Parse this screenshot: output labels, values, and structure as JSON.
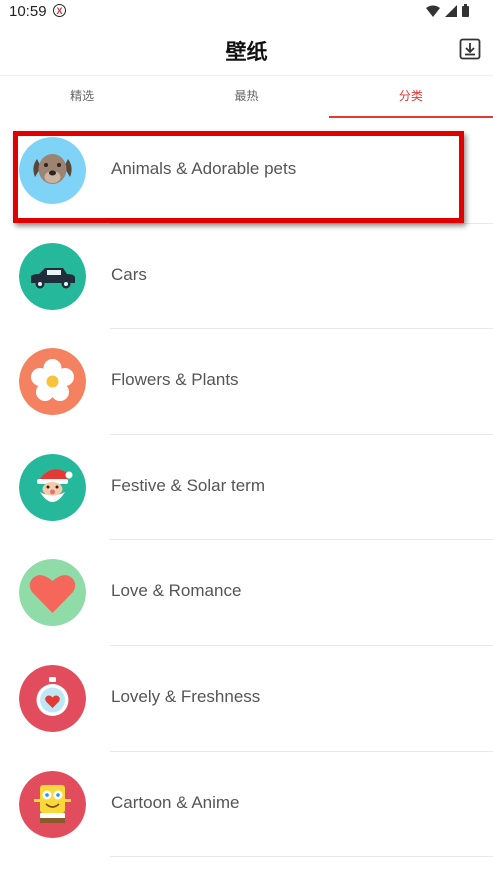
{
  "status_bar": {
    "time": "10:59",
    "notification_icon": "x-circle-icon",
    "icons": [
      "wifi-icon",
      "signal-icon",
      "battery-icon"
    ]
  },
  "header": {
    "title": "壁纸",
    "download_icon": "download-icon"
  },
  "tabs": [
    {
      "label": "精选",
      "active": false
    },
    {
      "label": "最热",
      "active": false
    },
    {
      "label": "分类",
      "active": true
    }
  ],
  "categories": [
    {
      "label": "Animals & Adorable pets",
      "icon": "dog-icon",
      "color": "#7fd3f7"
    },
    {
      "label": "Cars",
      "icon": "car-icon",
      "color": "#26b89a"
    },
    {
      "label": "Flowers & Plants",
      "icon": "flower-icon",
      "color": "#f4815f"
    },
    {
      "label": "Festive & Solar term",
      "icon": "santa-icon",
      "color": "#26b89a"
    },
    {
      "label": "Love & Romance",
      "icon": "heart-icon",
      "color": "#8fdca8"
    },
    {
      "label": "Lovely & Freshness",
      "icon": "stopwatch-heart-icon",
      "color": "#e24d5e"
    },
    {
      "label": "Cartoon & Anime",
      "icon": "sponge-character-icon",
      "color": "#e24d5e"
    }
  ],
  "colors": {
    "accent": "#e53935",
    "highlight_border": "#e00000"
  }
}
